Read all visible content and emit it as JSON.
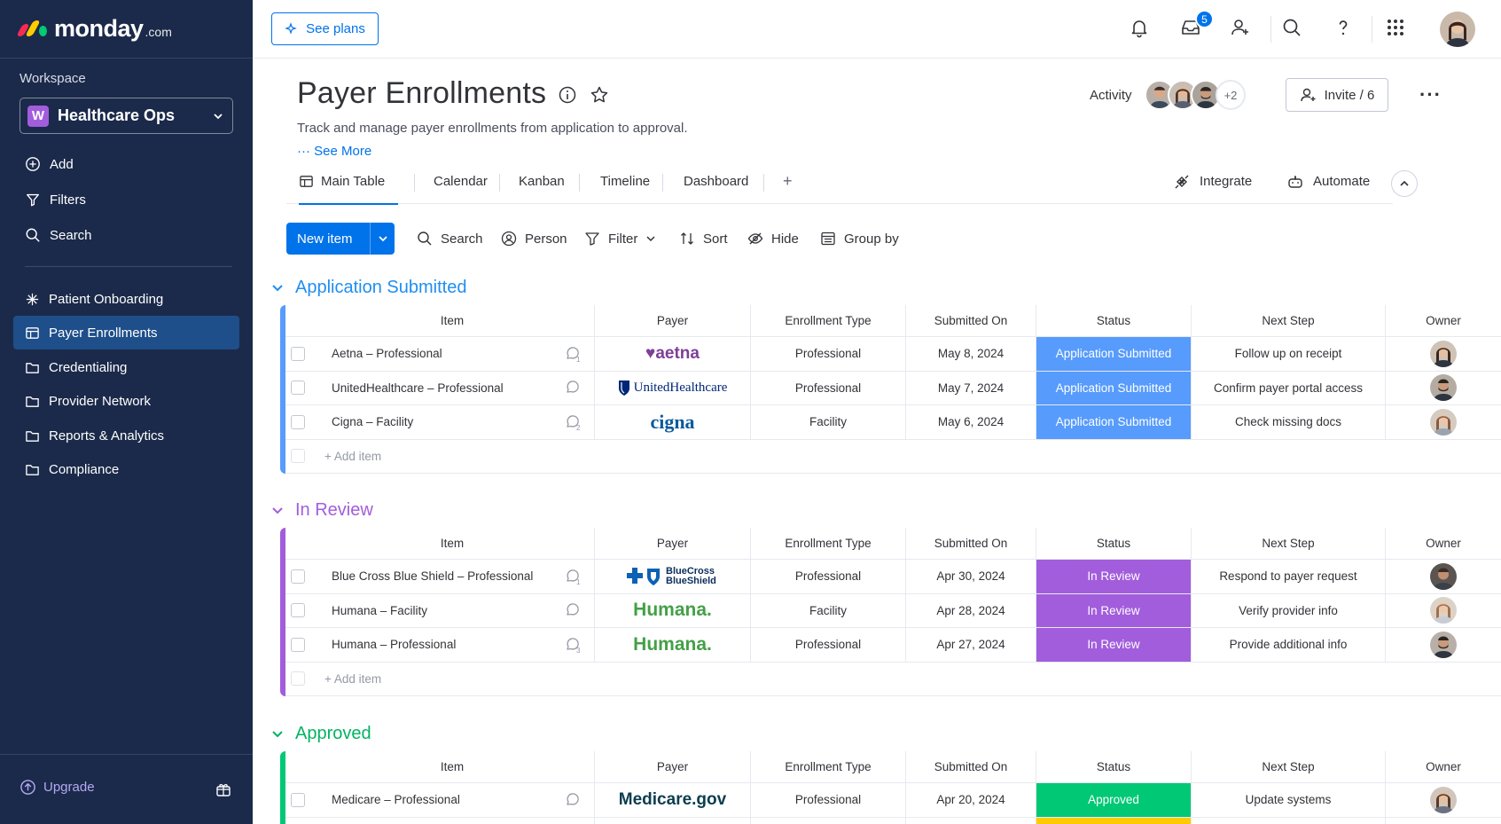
{
  "brand": {
    "word": "monday",
    "suffix": ".com"
  },
  "sidebar": {
    "workspace_label": "Workspace",
    "workspace_badge": "W",
    "workspace_name": "Healthcare Ops",
    "actions": [
      {
        "label": "Add",
        "icon": "plus-circle-icon"
      },
      {
        "label": "Filters",
        "icon": "filter-icon"
      },
      {
        "label": "Search",
        "icon": "search-icon"
      }
    ],
    "boards": [
      {
        "label": "Patient Onboarding",
        "icon": "sparkle-icon"
      },
      {
        "label": "Payer Enrollments",
        "icon": "board-icon",
        "active": true
      },
      {
        "label": "Credentialing",
        "icon": "folder-icon"
      },
      {
        "label": "Provider Network",
        "icon": "folder-icon"
      },
      {
        "label": "Reports & Analytics",
        "icon": "folder-icon"
      },
      {
        "label": "Compliance",
        "icon": "folder-icon"
      }
    ],
    "upgrade_label": "Upgrade"
  },
  "topbar": {
    "see_plans": "See plans",
    "inbox_count": "5"
  },
  "header": {
    "title": "Payer Enrollments",
    "description": "Track and manage payer enrollments from application to approval.",
    "see_more": "··· See More",
    "activity_label": "Activity",
    "activity_more": "+2",
    "invite_label": "Invite / 6"
  },
  "tabs": {
    "items": [
      "Main Table",
      "Calendar",
      "Kanban",
      "Timeline",
      "Dashboard"
    ],
    "add": "+",
    "integrate": "Integrate",
    "automate": "Automate"
  },
  "toolbar": {
    "new_item": "New item",
    "search": "Search",
    "person": "Person",
    "filter": "Filter",
    "sort": "Sort",
    "hide": "Hide",
    "group_by": "Group by"
  },
  "columns": [
    "Item",
    "Payer",
    "Enrollment Type",
    "Submitted On",
    "Status",
    "Next Step",
    "Owner"
  ],
  "add_item": "+ Add item",
  "colors": {
    "blue": "#579bfc",
    "purple": "#a25ddc",
    "green": "#00c875",
    "brand_blue": "#0073ea",
    "yellow": "#ffcb00"
  },
  "groups": [
    {
      "name": "Application Submitted",
      "color": "#579bfc",
      "title_color": "#1f8ef1",
      "rows": [
        {
          "item": "Aetna – Professional",
          "payer": "♥aetna",
          "type": "Professional",
          "date": "May 8, 2024",
          "status": "Application Submitted",
          "next": "Follow up on receipt",
          "comment": "1"
        },
        {
          "item": "UnitedHealthcare – Professional",
          "payer": "UnitedHealthcare",
          "type": "Professional",
          "date": "May 7, 2024",
          "status": "Application Submitted",
          "next": "Confirm payer portal access",
          "comment": ""
        },
        {
          "item": "Cigna – Facility",
          "payer": "cigna",
          "type": "Facility",
          "date": "May 6, 2024",
          "status": "Application Submitted",
          "next": "Check missing docs",
          "comment": "2"
        }
      ]
    },
    {
      "name": "In Review",
      "color": "#a25ddc",
      "title_color": "#a25ddc",
      "rows": [
        {
          "item": "Blue Cross Blue Shield – Professional",
          "payer": "BlueCross BlueShield",
          "type": "Professional",
          "date": "Apr 30, 2024",
          "status": "In Review",
          "next": "Respond to payer request",
          "comment": "1"
        },
        {
          "item": "Humana – Facility",
          "payer": "Humana.",
          "type": "Facility",
          "date": "Apr 28, 2024",
          "status": "In Review",
          "next": "Verify provider info",
          "comment": ""
        },
        {
          "item": "Humana – Professional",
          "payer": "Humana.",
          "type": "Professional",
          "date": "Apr 27, 2024",
          "status": "In Review",
          "next": "Provide additional info",
          "comment": "3"
        }
      ]
    },
    {
      "name": "Approved",
      "color": "#00c875",
      "title_color": "#00b461",
      "rows": [
        {
          "item": "Medicare – Professional",
          "payer": "Medicare.gov",
          "type": "Professional",
          "date": "Apr 20, 2024",
          "status": "Approved",
          "next": "Update systems",
          "comment": ""
        }
      ]
    }
  ]
}
